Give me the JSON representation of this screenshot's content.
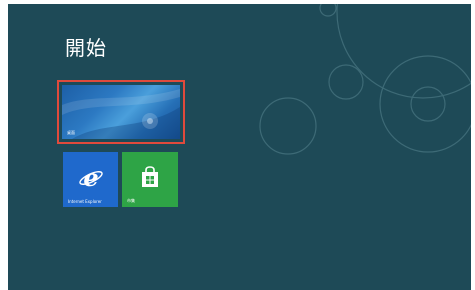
{
  "start_screen": {
    "title": "開始",
    "background_color": "#1e4a57",
    "highlight_color": "#e04a3c",
    "tiles": [
      {
        "label": "桌面",
        "icon": "desktop-wallpaper",
        "color": "#2c79c2"
      },
      {
        "label": "Internet Explorer",
        "icon": "ie-icon",
        "color": "#1f69cc"
      },
      {
        "label": "市集",
        "icon": "store-bag-icon",
        "color": "#2ea446"
      }
    ]
  }
}
